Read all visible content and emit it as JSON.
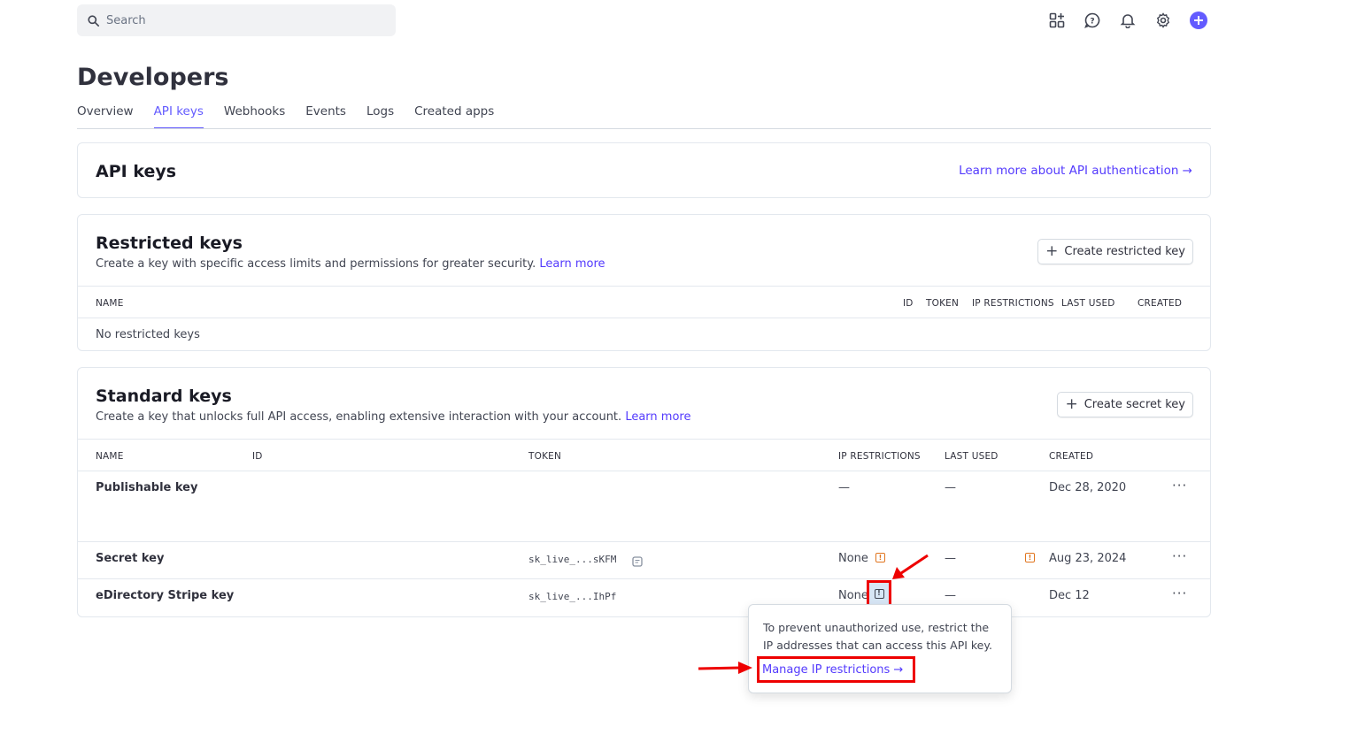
{
  "search": {
    "placeholder": "Search"
  },
  "top_icons": [
    "apps-grid-icon",
    "help-icon",
    "bell-icon",
    "gear-icon",
    "plus-circle-icon"
  ],
  "page": {
    "title": "Developers"
  },
  "tabs": [
    {
      "label": "Overview"
    },
    {
      "label": "API keys",
      "active": true
    },
    {
      "label": "Webhooks"
    },
    {
      "label": "Events"
    },
    {
      "label": "Logs"
    },
    {
      "label": "Created apps"
    }
  ],
  "api_keys": {
    "title": "API keys",
    "learn_link": "Learn more about API authentication →"
  },
  "restricted": {
    "title": "Restricted keys",
    "subtitle": "Create a key with specific access limits and permissions for greater security.",
    "learn_more": "Learn more",
    "create_button": "Create restricted key",
    "columns": {
      "name": "NAME",
      "id": "ID",
      "token": "TOKEN",
      "ip": "IP RESTRICTIONS",
      "last_used": "LAST USED",
      "created": "CREATED"
    },
    "empty": "No restricted keys"
  },
  "standard": {
    "title": "Standard keys",
    "subtitle": "Create a key that unlocks full API access, enabling extensive interaction with your account.",
    "learn_more": "Learn more",
    "create_button": "Create secret key",
    "columns": {
      "name": "NAME",
      "id": "ID",
      "token": "TOKEN",
      "ip": "IP RESTRICTIONS",
      "last_used": "LAST USED",
      "created": "CREATED"
    },
    "rows": [
      {
        "name": "Publishable key",
        "token": "",
        "ip": "—",
        "last_used": "—",
        "created": "Dec 28, 2020"
      },
      {
        "name": "Secret key",
        "token": "sk_live_...sKFM",
        "ip": "None",
        "last_used": "—",
        "created": "Aug 23, 2024"
      },
      {
        "name": "eDirectory Stripe key",
        "token": "sk_live_...IhPf",
        "ip": "None",
        "last_used": "—",
        "created": "Dec 12"
      }
    ]
  },
  "tooltip": {
    "text": "To prevent unauthorized use, restrict the IP addresses that can access this API key.",
    "link": "Manage IP restrictions →"
  },
  "colors": {
    "accent": "#635bff",
    "warning": "#e0751f",
    "annotation": "#ee0000"
  }
}
